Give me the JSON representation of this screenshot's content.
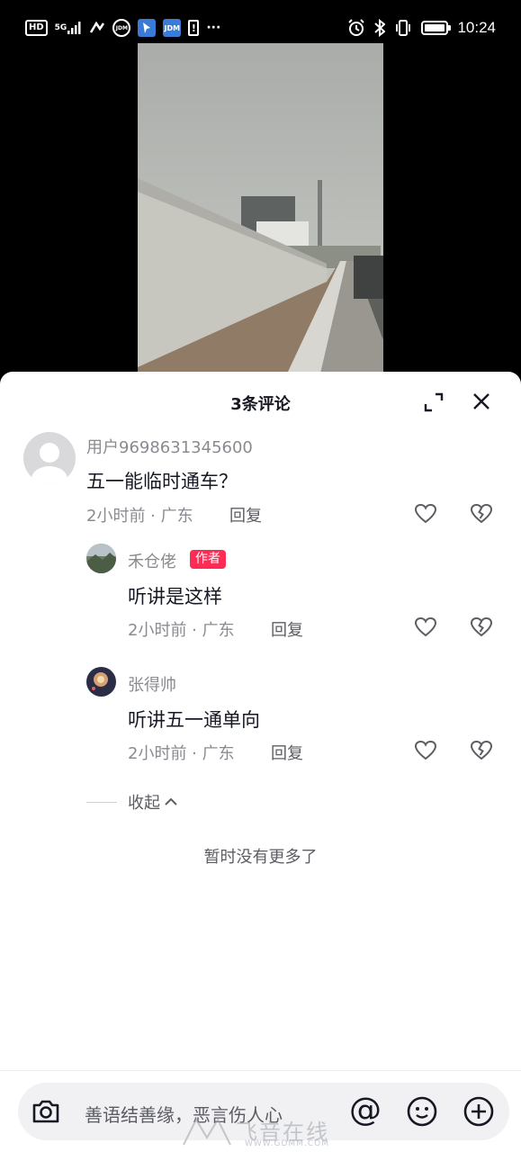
{
  "status_bar": {
    "left_icons": [
      "hd-icon",
      "5g-signal-icon",
      "nfc-icon",
      "jdm-circle-icon",
      "map-pin-app-icon",
      "jdm-square-icon",
      "alert-icon",
      "more-dots-icon"
    ],
    "hd": "HD",
    "network": "5G",
    "jdm": "JDM",
    "alert": "!",
    "more": "···",
    "time": "10:24"
  },
  "header": {
    "title": "3条评论"
  },
  "comments": [
    {
      "username": "用户9698631345600",
      "text": "五一能临时通车？",
      "meta": "2小时前 · 广东",
      "reply": "回复"
    },
    {
      "username": "禾仓佬",
      "author_tag": "作者",
      "text": "听讲是这样",
      "meta": "2小时前 · 广东",
      "reply": "回复"
    },
    {
      "username": "张得帅",
      "text": "听讲五一通单向",
      "meta": "2小时前 · 广东",
      "reply": "回复"
    }
  ],
  "collapse_label": "收起",
  "no_more_text": "暂时没有更多了",
  "input": {
    "placeholder": "善语结善缘，恶言伤人心",
    "at_symbol": "@"
  },
  "watermark": {
    "main": "飞音在线",
    "sub": "WWW.GDMM.COM"
  },
  "colors": {
    "author_tag": "#fe2c55",
    "text_primary": "#161823",
    "text_secondary": "#8a8b91"
  }
}
